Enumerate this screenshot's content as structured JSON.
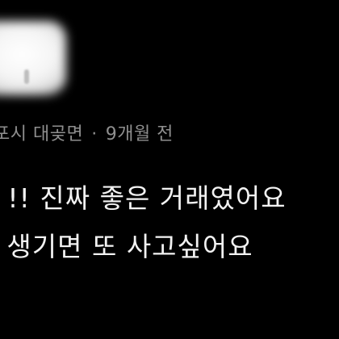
{
  "profile": {
    "avatar_icon": "blurred-profile-avatar-icon"
  },
  "meta": {
    "location": "포시 대곶면",
    "separator": "·",
    "time_ago": "9개월 전"
  },
  "review": {
    "line1": "t !! 진짜 좋은 거래였어요",
    "line2": "- 생기면 또 사고싶어요"
  },
  "colors": {
    "background": "#000000",
    "meta_text": "#8f8f8f",
    "body_text": "#f2f2f2"
  }
}
